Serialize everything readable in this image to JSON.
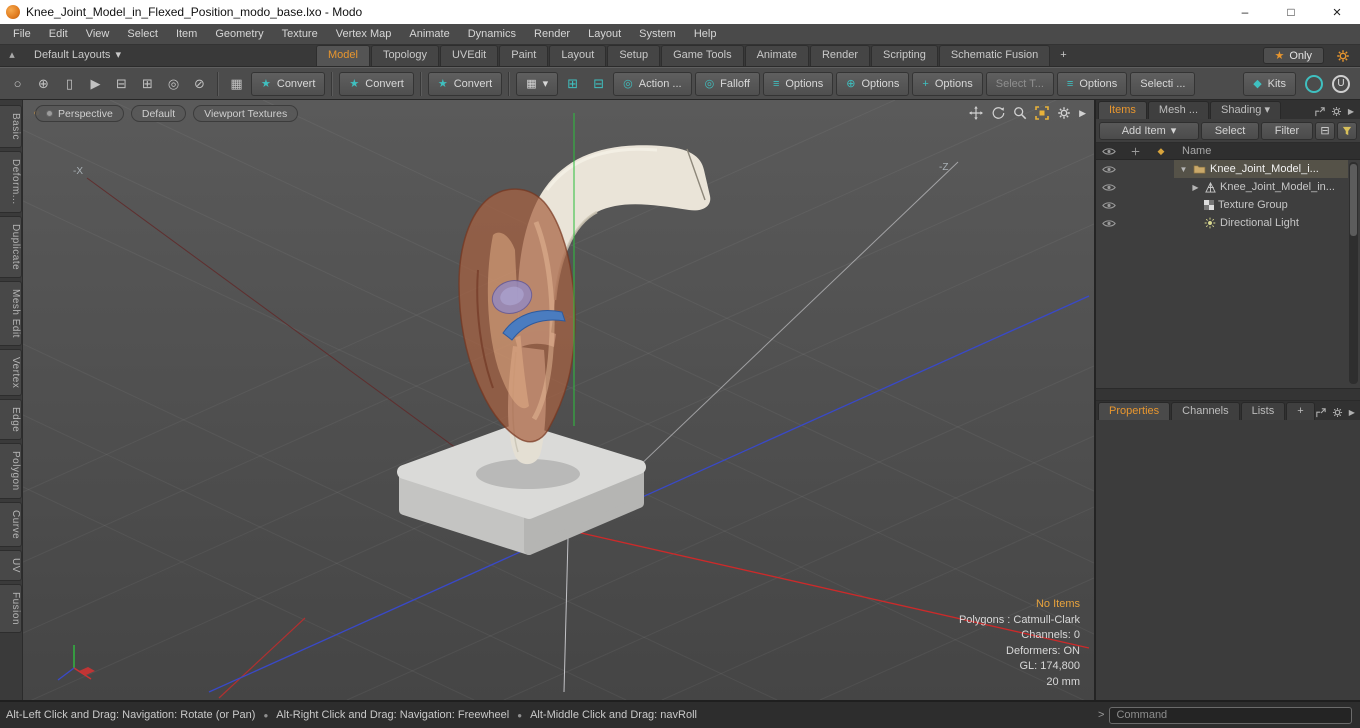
{
  "window": {
    "title": "Knee_Joint_Model_in_Flexed_Position_modo_base.lxo - Modo"
  },
  "menubar": {
    "items": [
      "File",
      "Edit",
      "View",
      "Select",
      "Item",
      "Geometry",
      "Texture",
      "Vertex Map",
      "Animate",
      "Dynamics",
      "Render",
      "Layout",
      "System",
      "Help"
    ]
  },
  "layout_bar": {
    "layouts_dropdown": "Default Layouts",
    "tabs": [
      "Model",
      "Topology",
      "UVEdit",
      "Paint",
      "Layout",
      "Setup",
      "Game Tools",
      "Animate",
      "Render",
      "Scripting",
      "Schematic Fusion"
    ],
    "add_tab": "+",
    "only_button": "Only"
  },
  "toolbar": {
    "convert_label": "Convert",
    "action_label": "Action ...",
    "falloff_label": "Falloff",
    "options_label": "Options",
    "select_t_label": "Select T...",
    "selecti_label": "Selecti ...",
    "kits_label": "Kits"
  },
  "left_tabs": {
    "items": [
      "Basic",
      "Deform...",
      "Duplicate",
      "Mesh Edit",
      "Vertex",
      "Edge",
      "Polygon",
      "Curve",
      "UV",
      "Fusion"
    ]
  },
  "viewport": {
    "camera_button": "Perspective",
    "style_button": "Default",
    "textures_button": "Viewport Textures",
    "neg_x_label": "-X",
    "neg_z_label": "-Z",
    "stats": [
      "No Items",
      "Polygons : Catmull-Clark",
      "Channels: 0",
      "Deformers: ON",
      "GL: 174,800",
      "20 mm"
    ]
  },
  "right_panel": {
    "tabs": [
      "Items",
      "Mesh ...",
      "Shading"
    ],
    "add_item_button": "Add Item",
    "select_button": "Select",
    "filter_button": "Filter",
    "name_header": "Name",
    "tree": [
      {
        "label": "Knee_Joint_Model_i..."
      },
      {
        "label": "Knee_Joint_Model_in..."
      },
      {
        "label": "Texture Group"
      },
      {
        "label": "Directional Light"
      }
    ],
    "lower_tabs": [
      "Properties",
      "Channels",
      "Lists"
    ],
    "add_lower_tab": "+",
    "command_prompt": ">",
    "command_placeholder": "Command"
  },
  "statusbar": {
    "hints": [
      "Alt-Left Click and Drag: Navigation: Rotate (or Pan)",
      "Alt-Right Click and Drag: Navigation: Freewheel",
      "Alt-Middle Click and Drag: navRoll"
    ],
    "separator": "●"
  },
  "icons": {
    "minimize": "–",
    "maximize": "□",
    "close": "×",
    "layouts_home": "▴",
    "dropdown_arrow": "▾",
    "star": "★",
    "ellipse_tool": "○",
    "sphere_tool": "⊕",
    "capsule_tool": "▯",
    "cursor_tool": "▶",
    "mirror_tool": "⊟",
    "array_tool": "⊞",
    "radial_tool": "◎",
    "slice_tool": "⊘",
    "cube_tool": "▦",
    "convert": "★",
    "action": "◎",
    "falloff": "◎",
    "options_a": "≡",
    "options_b": "⊕",
    "options_c": "+",
    "kits": "◆",
    "u_badge": "U",
    "panel_arrow": "▶",
    "tree_expand_open": "▼",
    "tree_expand_closed": "▶",
    "header_render": "◆",
    "small_button": "⊟"
  },
  "colors": {
    "accent_orange": "#e8962e",
    "teal": "#3fc0c0",
    "axis_x": "#cc2a2a",
    "axis_y": "#2fbf3f",
    "axis_z": "#3949c8"
  }
}
